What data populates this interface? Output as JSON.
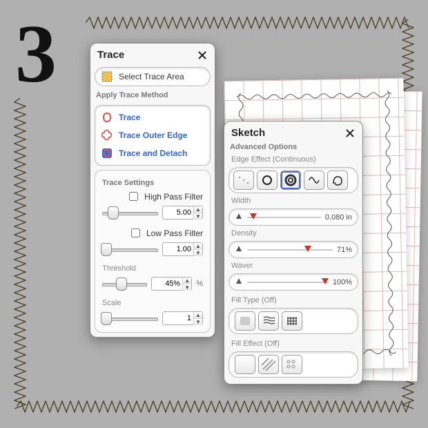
{
  "numeral": "3",
  "trace": {
    "title": "Trace",
    "select_area": "Select Trace Area",
    "apply_heading": "Apply Trace Method",
    "methods": {
      "trace": "Trace",
      "outer": "Trace Outer Edge",
      "detach": "Trace and Detach"
    },
    "settings_heading": "Trace Settings",
    "high_pass": {
      "label": "High Pass Filter",
      "checked": false,
      "value": "5.00",
      "thumb_pct": 18
    },
    "low_pass": {
      "label": "Low Pass Filter",
      "checked": false,
      "value": "1.00",
      "thumb_pct": 6
    },
    "threshold": {
      "label": "Threshold",
      "value": "45%",
      "thumb_pct": 42,
      "unit": "%"
    },
    "scale": {
      "label": "Scale",
      "value": "1",
      "thumb_pct": 6
    }
  },
  "sketch": {
    "title": "Sketch",
    "advanced": "Advanced Options",
    "edge_effect": {
      "label": "Edge Effect",
      "paren": "(Continuous)",
      "selected_index": 2
    },
    "width": {
      "label": "Width",
      "value": "0.080 in",
      "marker_pct": 8
    },
    "density": {
      "label": "Density",
      "value": "71%",
      "marker_pct": 71
    },
    "waver": {
      "label": "Waver",
      "value": "100%",
      "marker_pct": 100
    },
    "fill_type": {
      "label": "Fill Type",
      "paren": "(Off)"
    },
    "fill_effect": {
      "label": "Fill Effect",
      "paren": "(Off)"
    }
  }
}
